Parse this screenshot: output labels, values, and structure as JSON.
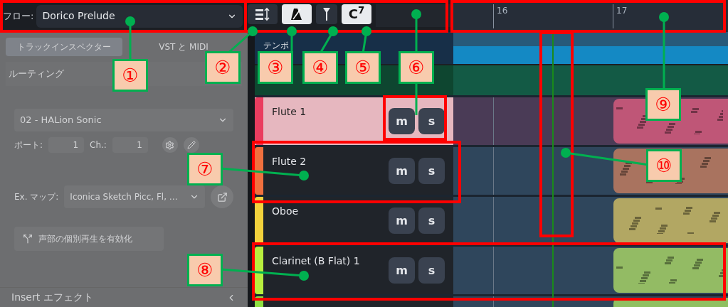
{
  "flow": {
    "label": "フロー:",
    "value": "Dorico Prelude"
  },
  "toolbar": [
    {
      "kind": "track-height",
      "on": false
    },
    {
      "kind": "metronome",
      "on": true
    },
    {
      "kind": "filter",
      "on": false
    },
    {
      "kind": "chord",
      "text": "C$^{7}$",
      "on": true
    }
  ],
  "ruler": {
    "bars": [
      "16",
      "17"
    ]
  },
  "inspector": {
    "tabs": [
      {
        "label": "トラックインスペクター",
        "selected": true
      },
      {
        "label": "VST と MIDI",
        "selected": false
      }
    ],
    "routing_title": "ルーティング",
    "instrument": "02 - HALion Sonic",
    "port_label": "ポート:",
    "port": "1",
    "channel_label": "Ch.:",
    "channel": "1",
    "map_label": "Ex. マップ:",
    "map": "Iconica Sketch Picc, Fl, …",
    "solo_button": "声部の個別再生を有効化",
    "insert_title": "Insert エフェクト"
  },
  "tempo_track": {
    "name": "テンポ"
  },
  "tracks": [
    {
      "name": "Flute 1",
      "color": "#ea3d5f",
      "region": {
        "color": "#bf5677"
      },
      "selected": true,
      "buttons": [
        "m",
        "s"
      ]
    },
    {
      "name": "Flute 2",
      "color": "#f0703e",
      "region": {
        "color": "#a9735f"
      },
      "selected": false,
      "buttons": [
        "m",
        "s"
      ]
    },
    {
      "name": "Oboe",
      "color": "#f2d23c",
      "region": {
        "color": "#b2a763"
      },
      "selected": false,
      "buttons": [
        "m",
        "s"
      ]
    },
    {
      "name": "Clarinet (B Flat) 1",
      "color": "#b8ef3e",
      "region": {
        "color": "#93bb64"
      },
      "selected": false,
      "buttons": [
        "m",
        "s"
      ]
    },
    {
      "color": "#8ee040",
      "region": {
        "color": "#8fc060"
      },
      "selected": false
    }
  ],
  "annotations": [
    {
      "label": "①"
    },
    {
      "label": "②"
    },
    {
      "label": "③"
    },
    {
      "label": "④"
    },
    {
      "label": "⑤"
    },
    {
      "label": "⑥"
    },
    {
      "label": "⑦"
    },
    {
      "label": "⑧"
    },
    {
      "label": "⑨"
    },
    {
      "label": "⑩"
    }
  ]
}
